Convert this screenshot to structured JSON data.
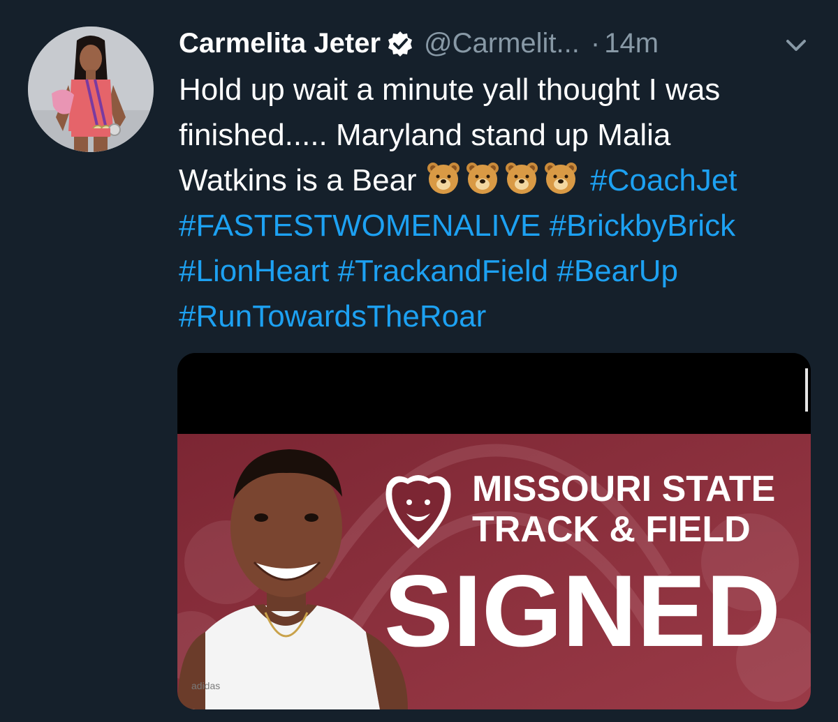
{
  "tweet": {
    "author": {
      "name": "Carmelita Jeter",
      "handle": "@Carmelit...",
      "verified": true
    },
    "separator": "·",
    "time": "14m",
    "text": {
      "line1": "Hold up wait a minute yall thought I was",
      "line2": "finished..... Maryland stand up Malia",
      "line3_prefix": "Watkins is a Bear",
      "emoji": [
        "bear-face",
        "bear-face",
        "bear-face",
        "bear-face"
      ],
      "hashtags": [
        "#CoachJet",
        "#FASTESTWOMENALIVE",
        "#BrickbyBrick",
        "#LionHeart",
        "#TrackandField",
        "#BearUp",
        "#RunTowardsTheRoar"
      ]
    },
    "media": {
      "headline_line1": "MISSOURI STATE",
      "headline_line2": "TRACK & FIELD",
      "status": "SIGNED",
      "shirt_brand": "adidas"
    }
  },
  "colors": {
    "background": "#15202b",
    "text": "#ffffff",
    "muted": "#8899a6",
    "link": "#1da1f2",
    "verified": "#ffffff",
    "banner_maroon": "#8a2f3a"
  },
  "icons": {
    "verified": "verified-badge-icon",
    "caret": "chevron-down-icon",
    "emoji": "bear-face-emoji"
  }
}
